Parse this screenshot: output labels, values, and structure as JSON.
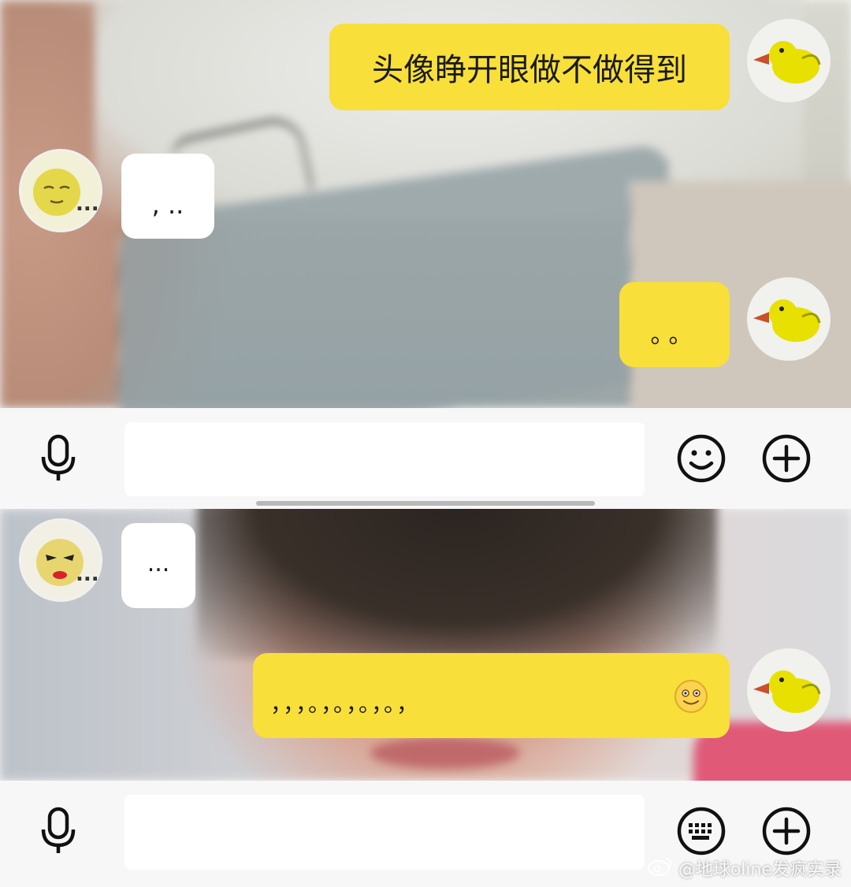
{
  "colors": {
    "my_bubble": "#f8df3a",
    "their_bubble": "#ffffff",
    "input_bar": "#f7f7f7"
  },
  "screen_top": {
    "messages": [
      {
        "sender": "me",
        "text": "头像睁开眼做不做得到",
        "avatar": "yellow-duck-icon"
      },
      {
        "sender": "them",
        "text": ", ..",
        "avatar": "sleepy-face-avatar",
        "name_truncated": "..."
      },
      {
        "sender": "me",
        "text": "。。",
        "avatar": "yellow-duck-icon"
      }
    ],
    "input_bar": {
      "left_icon": "microphone-icon",
      "right_icons": [
        "smiley-icon",
        "plus-icon"
      ]
    }
  },
  "screen_bottom": {
    "messages": [
      {
        "sender": "them",
        "text": "...",
        "avatar": "makeup-face-avatar",
        "name_truncated": "..."
      },
      {
        "sender": "me",
        "text": "，，，。，。，。，。，",
        "emoji": "smiling-emoji-icon",
        "avatar": "yellow-duck-icon"
      }
    ],
    "input_bar": {
      "left_icon": "microphone-icon",
      "right_icons": [
        "keyboard-icon",
        "plus-icon"
      ]
    }
  },
  "watermark": {
    "platform_icon": "weibo-icon",
    "text": "@地球oline发疯实录"
  }
}
